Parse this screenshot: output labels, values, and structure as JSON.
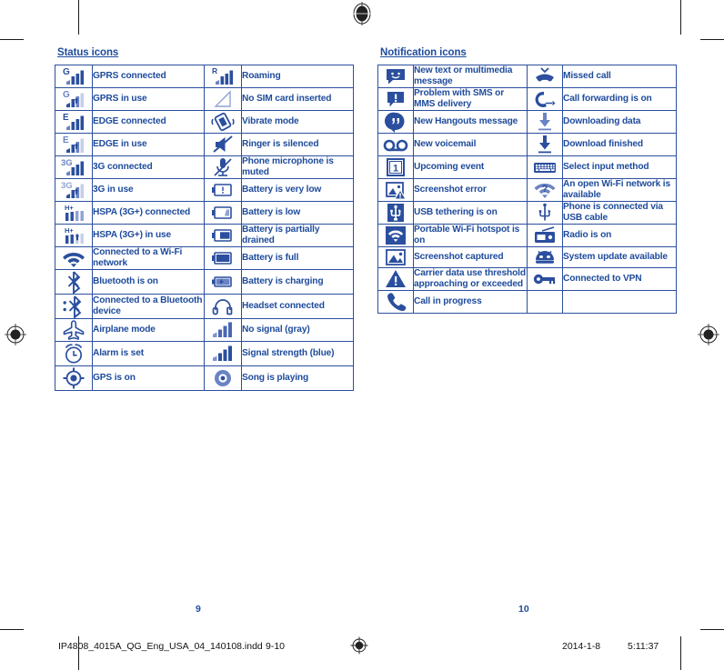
{
  "document": {
    "left_page": {
      "title": "Status icons",
      "page_number": "9",
      "rows": [
        {
          "icon_a": "gprs-connected-icon",
          "label_a": "GPRS connected",
          "icon_b": "roaming-icon",
          "label_b": "Roaming"
        },
        {
          "icon_a": "gprs-in-use-icon",
          "label_a": "GPRS in use",
          "icon_b": "no-sim-card-icon",
          "label_b": "No SIM card inserted"
        },
        {
          "icon_a": "edge-connected-icon",
          "label_a": "EDGE connected",
          "icon_b": "vibrate-mode-icon",
          "label_b": "Vibrate mode"
        },
        {
          "icon_a": "edge-in-use-icon",
          "label_a": "EDGE in use",
          "icon_b": "ringer-silenced-icon",
          "label_b": "Ringer is silenced"
        },
        {
          "icon_a": "3g-connected-icon",
          "label_a": "3G connected",
          "icon_b": "microphone-muted-icon",
          "label_b": "Phone microphone is muted"
        },
        {
          "icon_a": "3g-in-use-icon",
          "label_a": "3G in use",
          "icon_b": "battery-very-low-icon",
          "label_b": "Battery is very low"
        },
        {
          "icon_a": "hspa-connected-icon",
          "label_a": "HSPA (3G+) connected",
          "icon_b": "battery-low-icon",
          "label_b": "Battery is low"
        },
        {
          "icon_a": "hspa-in-use-icon",
          "label_a": "HSPA (3G+) in use",
          "icon_b": "battery-partially-drained-icon",
          "label_b": "Battery is partially drained"
        },
        {
          "icon_a": "wifi-connected-icon",
          "label_a": "Connected to a Wi-Fi network",
          "icon_b": "battery-full-icon",
          "label_b": "Battery is full"
        },
        {
          "icon_a": "bluetooth-on-icon",
          "label_a": "Bluetooth is on",
          "icon_b": "battery-charging-icon",
          "label_b": "Battery is charging"
        },
        {
          "icon_a": "bluetooth-connected-icon",
          "label_a": "Connected to a Bluetooth device",
          "icon_b": "headset-connected-icon",
          "label_b": "Headset connected"
        },
        {
          "icon_a": "airplane-mode-icon",
          "label_a": "Airplane mode",
          "icon_b": "no-signal-icon",
          "label_b": "No signal (gray)"
        },
        {
          "icon_a": "alarm-set-icon",
          "label_a": "Alarm is set",
          "icon_b": "signal-strength-icon",
          "label_b": "Signal strength (blue)"
        },
        {
          "icon_a": "gps-on-icon",
          "label_a": "GPS is on",
          "icon_b": "song-playing-icon",
          "label_b": "Song is playing"
        }
      ]
    },
    "right_page": {
      "title": "Notification icons",
      "page_number": "10",
      "rows": [
        {
          "icon_a": "new-message-icon",
          "label_a": "New text or multimedia message",
          "icon_b": "missed-call-icon",
          "label_b": "Missed call"
        },
        {
          "icon_a": "sms-problem-icon",
          "label_a": "Problem with SMS or MMS delivery",
          "icon_b": "call-forwarding-icon",
          "label_b": "Call forwarding is on"
        },
        {
          "icon_a": "hangouts-message-icon",
          "label_a": "New Hangouts message",
          "icon_b": "downloading-data-icon",
          "label_b": "Downloading data"
        },
        {
          "icon_a": "new-voicemail-icon",
          "label_a": "New voicemail",
          "icon_b": "download-finished-icon",
          "label_b": "Download finished"
        },
        {
          "icon_a": "upcoming-event-icon",
          "label_a": "Upcoming event",
          "icon_b": "select-input-method-icon",
          "label_b": "Select input method"
        },
        {
          "icon_a": "screenshot-error-icon",
          "label_a": "Screenshot error",
          "icon_b": "open-wifi-network-icon",
          "label_b": "An open Wi-Fi network is available"
        },
        {
          "icon_a": "usb-tethering-icon",
          "label_a": "USB tethering is on",
          "icon_b": "usb-cable-icon",
          "label_b": "Phone is connected via USB cable"
        },
        {
          "icon_a": "portable-hotspot-icon",
          "label_a": "Portable Wi-Fi hotspot is on",
          "icon_b": "radio-on-icon",
          "label_b": "Radio is on"
        },
        {
          "icon_a": "screenshot-captured-icon",
          "label_a": "Screenshot captured",
          "icon_b": "system-update-icon",
          "label_b": "System update available"
        },
        {
          "icon_a": "data-warning-icon",
          "label_a": "Carrier data use threshold approaching or exceeded",
          "icon_b": "vpn-connected-icon",
          "label_b": "Connected to VPN"
        },
        {
          "icon_a": "call-in-progress-icon",
          "label_a": "Call in progress",
          "icon_b": "",
          "label_b": ""
        }
      ]
    },
    "footer": {
      "filename": "IP4808_4015A_QG_Eng_USA_04_140108.indd",
      "page_range": "9-10",
      "date": "2014-1-8",
      "time": "5:11:37",
      "registration_mark": "registration-target-icon"
    },
    "colors": {
      "text_blue": "#1e4b9c",
      "border_blue": "#2b4f9e",
      "icon_blue": "#2b4f9e",
      "icon_light_blue": "#6a83c4",
      "footer_black": "#111111"
    }
  }
}
